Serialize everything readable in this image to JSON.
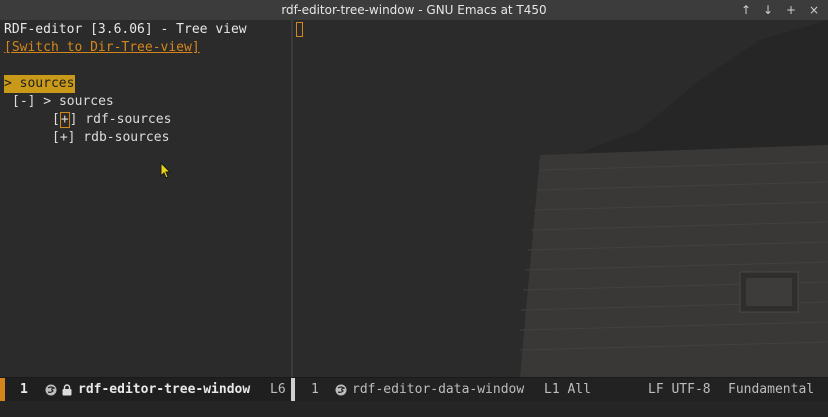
{
  "window": {
    "title": "rdf-editor-tree-window - GNU Emacs at T450",
    "controls": {
      "up": "↑",
      "down": "↓",
      "maximize": "+",
      "close": "×"
    }
  },
  "left_pane": {
    "header": "RDF-editor [3.6.06] - Tree view",
    "switch_link": "[Switch to Dir-Tree-view]",
    "selected_line": "> sources",
    "tree": {
      "root": "[-] > sources",
      "child1_open": "[",
      "child1_plus": "+",
      "child1_rest": "] rdf-sources",
      "child2": "[+] rdb-sources"
    }
  },
  "modeline": {
    "left": {
      "window_num": "1",
      "buffer_name": "rdf-editor-tree-window",
      "line": "L6"
    },
    "right": {
      "window_num": "1",
      "buffer_name": "rdf-editor-data-window",
      "position": "L1 All",
      "encoding": "LF UTF-8",
      "mode": "Fundamental"
    }
  },
  "colors": {
    "accent": "#d4861c",
    "selection": "#c99a1a",
    "background": "#2b2b2b"
  }
}
